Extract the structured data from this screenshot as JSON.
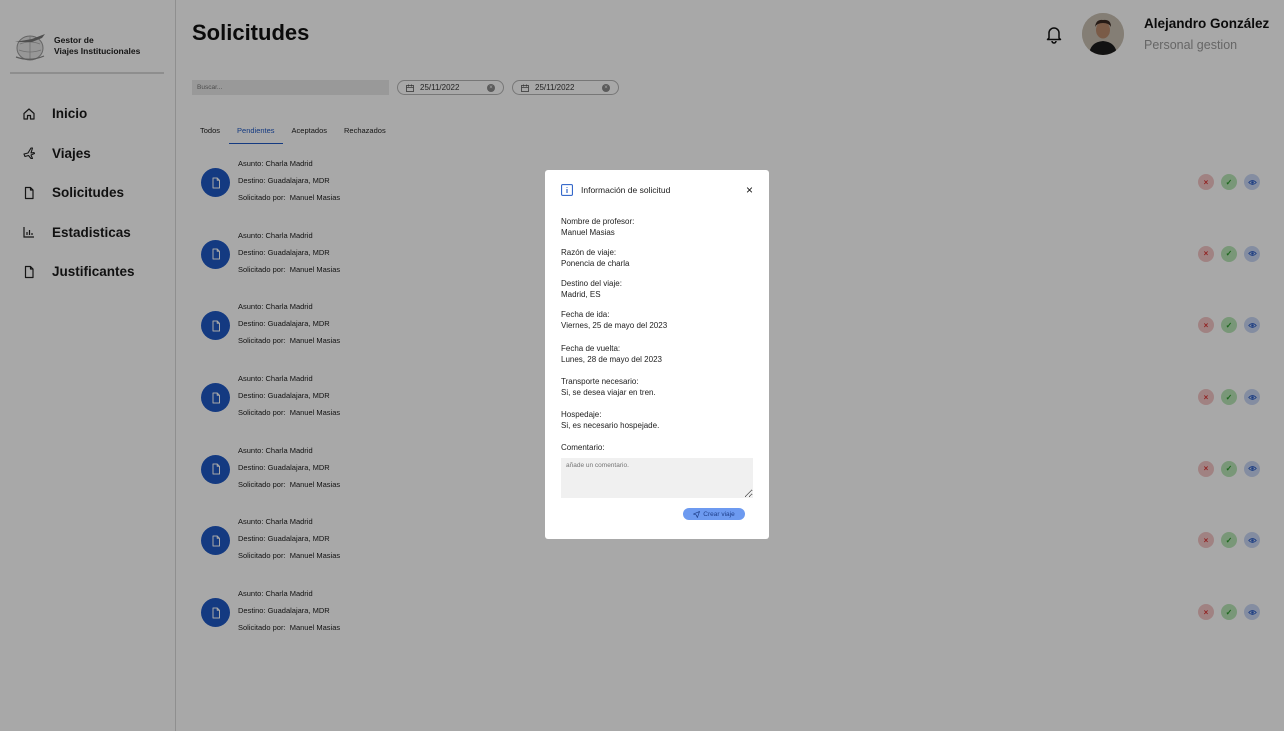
{
  "brand": {
    "line1": "Gestor de",
    "line2": "Viajes Institucionales"
  },
  "nav": [
    {
      "label": "Inicio",
      "icon": "home-icon"
    },
    {
      "label": "Viajes",
      "icon": "plane-icon"
    },
    {
      "label": "Solicitudes",
      "icon": "file-icon"
    },
    {
      "label": "Estadisticas",
      "icon": "bar-chart-icon"
    },
    {
      "label": "Justificantes",
      "icon": "file-icon"
    }
  ],
  "page": {
    "title": "Solicitudes"
  },
  "user": {
    "name": "Alejandro González",
    "role": "Personal gestion"
  },
  "filters": {
    "search_placeholder": "Buscar...",
    "date_from": "25/11/2022",
    "date_to": "25/11/2022"
  },
  "tabs": [
    {
      "label": "Todos"
    },
    {
      "label": "Pendientes",
      "active": true
    },
    {
      "label": "Aceptados"
    },
    {
      "label": "Rechazados"
    }
  ],
  "requests": [
    {
      "asunto": "Asunto: Charla Madrid",
      "destino": "Destino: Guadalajara, MDR",
      "solicitado_label": "Solicitado por:",
      "solicitado": "Manuel Masias"
    },
    {
      "asunto": "Asunto: Charla Madrid",
      "destino": "Destino: Guadalajara, MDR",
      "solicitado_label": "Solicitado por:",
      "solicitado": "Manuel Masias"
    },
    {
      "asunto": "Asunto: Charla Madrid",
      "destino": "Destino: Guadalajara, MDR",
      "solicitado_label": "Solicitado por:",
      "solicitado": "Manuel Masias"
    },
    {
      "asunto": "Asunto: Charla Madrid",
      "destino": "Destino: Guadalajara, MDR",
      "solicitado_label": "Solicitado por:",
      "solicitado": "Manuel Masias"
    },
    {
      "asunto": "Asunto: Charla Madrid",
      "destino": "Destino: Guadalajara, MDR",
      "solicitado_label": "Solicitado por:",
      "solicitado": "Manuel Masias"
    },
    {
      "asunto": "Asunto: Charla Madrid",
      "destino": "Destino: Guadalajara, MDR",
      "solicitado_label": "Solicitado por:",
      "solicitado": "Manuel Masias"
    },
    {
      "asunto": "Asunto: Charla Madrid",
      "destino": "Destino: Guadalajara, MDR",
      "solicitado_label": "Solicitado por:",
      "solicitado": "Manuel Masias"
    }
  ],
  "row_actions": {
    "reject": "×",
    "accept": "✓"
  },
  "modal": {
    "title": "Información de solicitud",
    "close": "×",
    "fields": [
      {
        "label": "Nombre de profesor:",
        "value": "Manuel Masias"
      },
      {
        "label": "Razón de viaje:",
        "value": "Ponencia de charla"
      },
      {
        "label": "Destino del viaje:",
        "value": "Madrid, ES"
      },
      {
        "label": "Fecha de ida:",
        "value": "Viernes, 25 de mayo del 2023"
      },
      {
        "label": "Fecha de vuelta:",
        "value": "Lunes, 28 de mayo del 2023"
      },
      {
        "label": "Transporte necesario:",
        "value": "Si, se desea viajar en tren."
      },
      {
        "label": "Hospedaje:",
        "value": "Si, es necesario hospejade."
      }
    ],
    "comment_label": "Comentario:",
    "comment_placeholder": "añade un comentario.",
    "submit_label": "Crear viaje"
  },
  "colors": {
    "accent": "#1f58c4",
    "reject": "#d33",
    "accept": "#2c9a2c",
    "overlay": "rgba(0,0,0,0.34)"
  }
}
